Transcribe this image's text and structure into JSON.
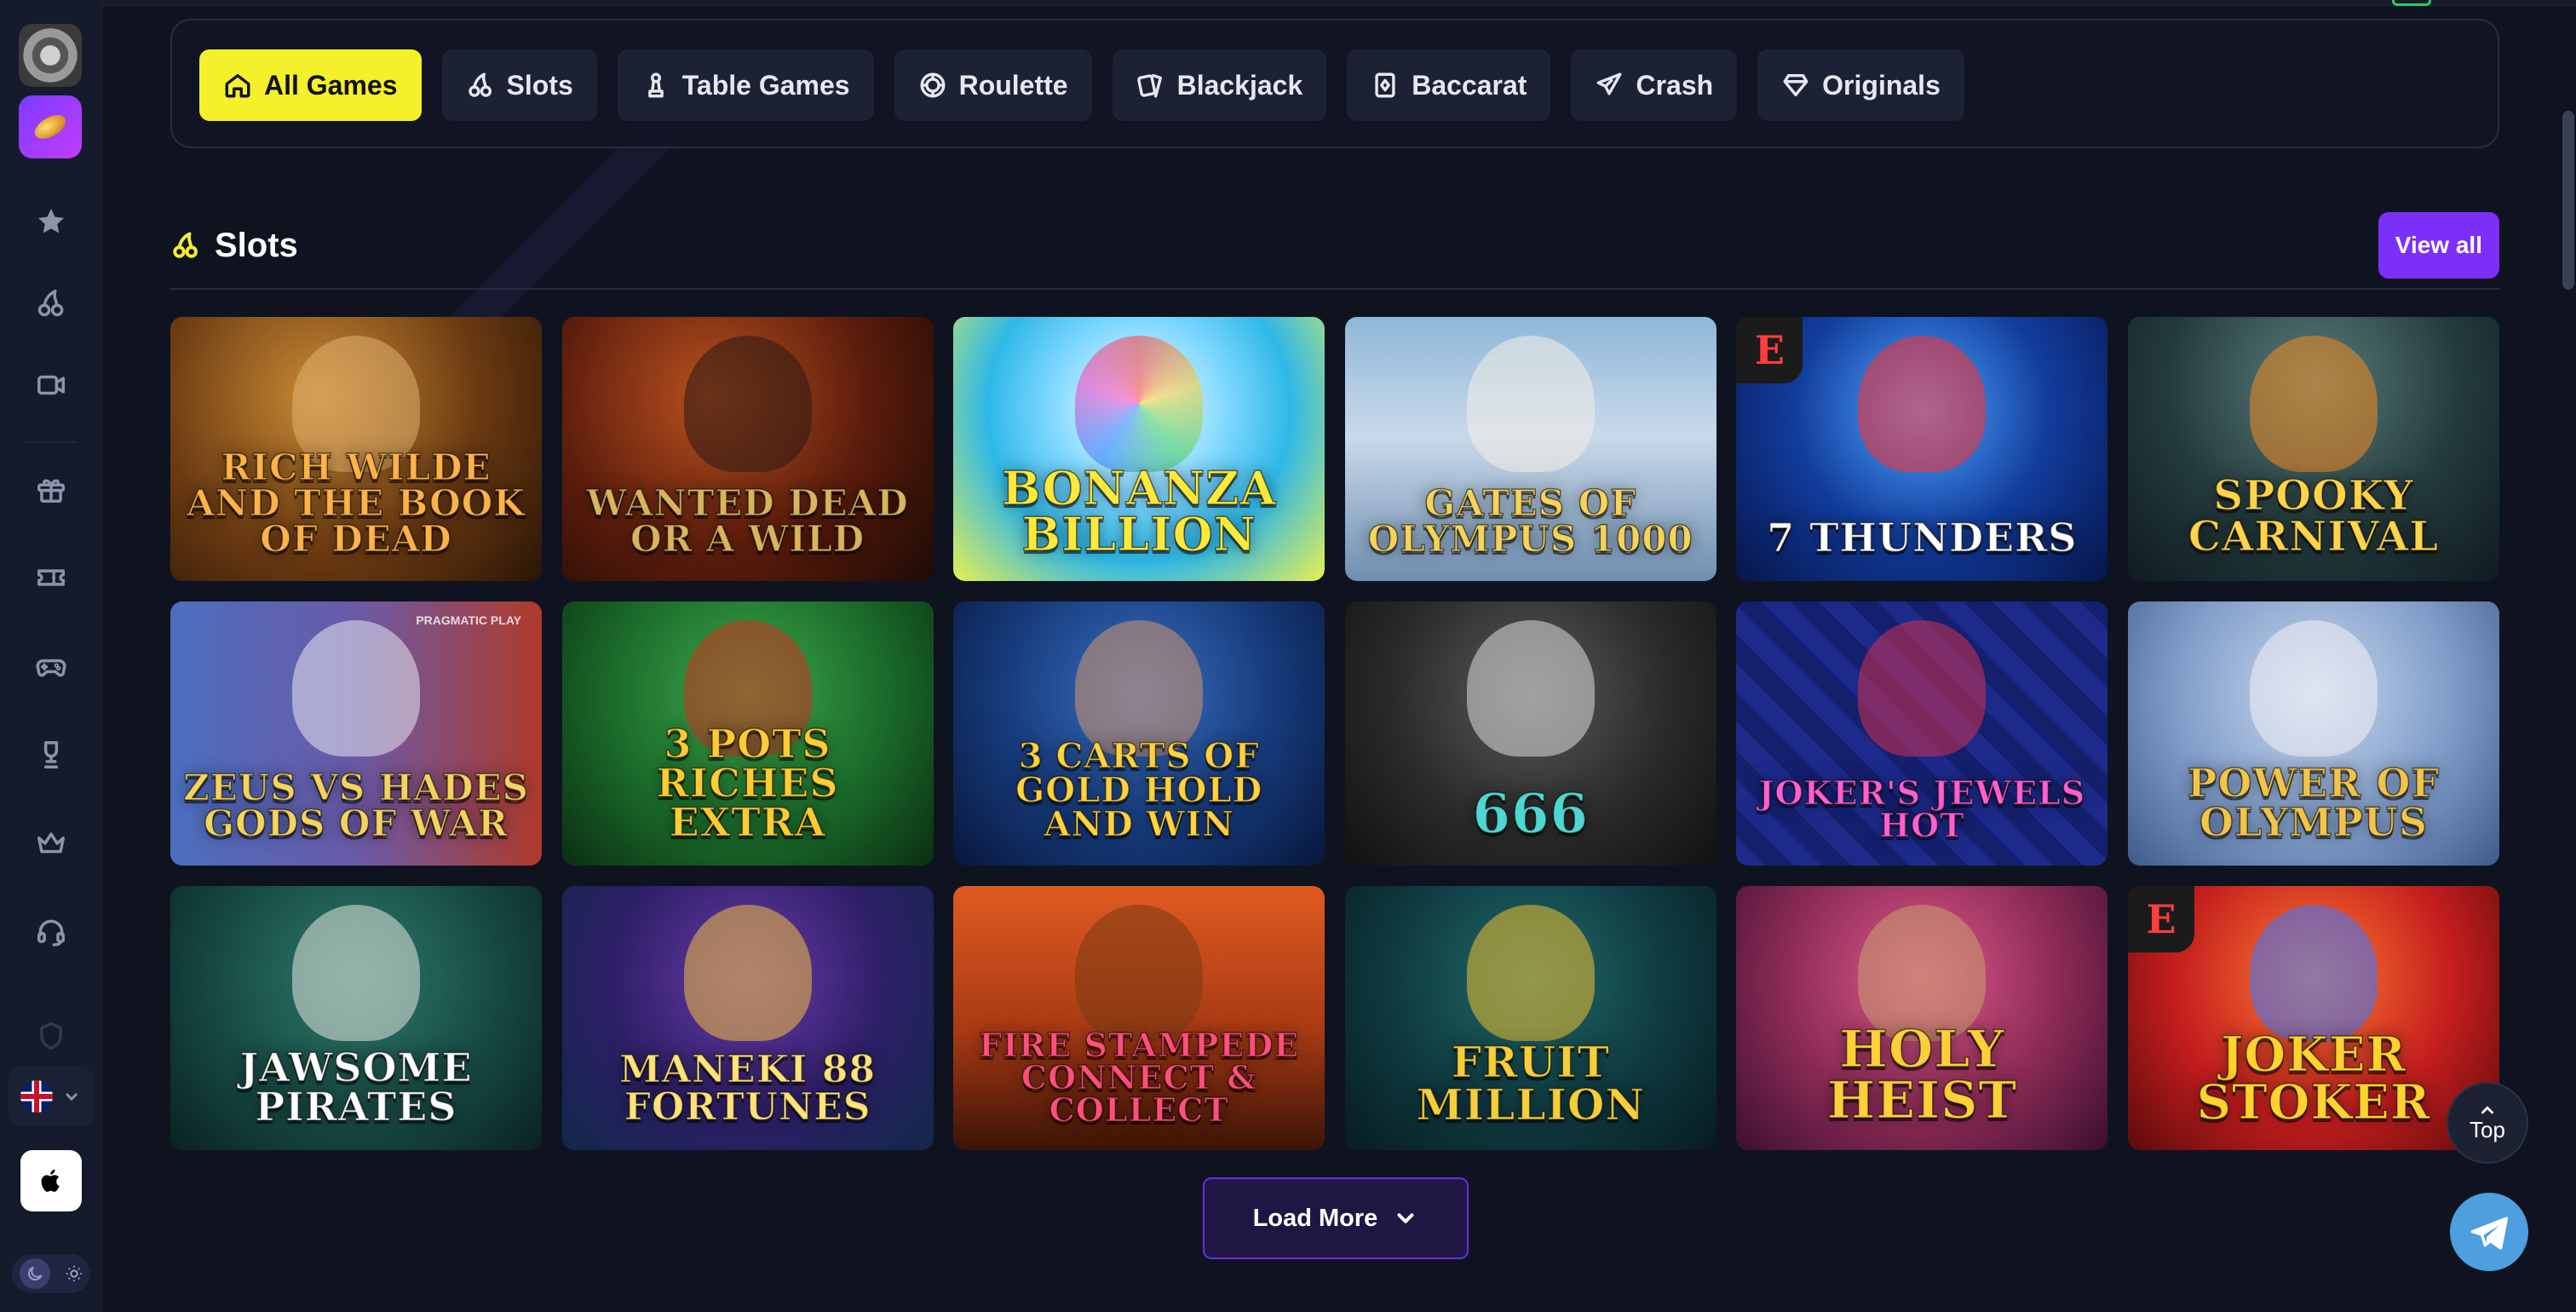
{
  "filters": [
    {
      "label": "All Games",
      "icon": "home-icon",
      "active": true
    },
    {
      "label": "Slots",
      "icon": "cherries-icon",
      "active": false
    },
    {
      "label": "Table Games",
      "icon": "chess-pawn-icon",
      "active": false
    },
    {
      "label": "Roulette",
      "icon": "roulette-wheel-icon",
      "active": false
    },
    {
      "label": "Blackjack",
      "icon": "playing-cards-icon",
      "active": false
    },
    {
      "label": "Baccarat",
      "icon": "card-diamond-icon",
      "active": false
    },
    {
      "label": "Crash",
      "icon": "plane-icon",
      "active": false
    },
    {
      "label": "Originals",
      "icon": "diamond-icon",
      "active": false
    }
  ],
  "section": {
    "title": "Slots",
    "icon": "cherries-icon",
    "view_all": "View all"
  },
  "games": [
    {
      "name": "Rich Wilde and the Book of Dead",
      "provider_badge": ""
    },
    {
      "name": "Wanted Dead or a Wild",
      "provider_badge": ""
    },
    {
      "name": "Bonanza Billion",
      "provider_badge": ""
    },
    {
      "name": "Gates of Olympus 1000",
      "provider_badge": ""
    },
    {
      "name": "7 Thunders",
      "provider_badge": "E"
    },
    {
      "name": "Spooky Carnival",
      "provider_badge": ""
    },
    {
      "name": "Zeus vs Hades Gods of War",
      "provider_badge": "",
      "corner_label": "PRAGMATIC PLAY"
    },
    {
      "name": "3 Pots Riches Extra",
      "provider_badge": ""
    },
    {
      "name": "3 Carts of Gold Hold and Win",
      "provider_badge": ""
    },
    {
      "name": "666",
      "provider_badge": ""
    },
    {
      "name": "Joker's Jewels Hot",
      "provider_badge": ""
    },
    {
      "name": "Power of Olympus",
      "provider_badge": ""
    },
    {
      "name": "Jawsome Pirates",
      "provider_badge": ""
    },
    {
      "name": "Maneki 88 Fortunes",
      "provider_badge": ""
    },
    {
      "name": "Fire Stampede Connect & Collect",
      "provider_badge": ""
    },
    {
      "name": "Fruit Million",
      "provider_badge": ""
    },
    {
      "name": "Holy Heist",
      "provider_badge": ""
    },
    {
      "name": "Joker Stoker",
      "provider_badge": "E"
    }
  ],
  "load_more": "Load More",
  "top_button": "Top",
  "sidebar": {
    "nav_icons": [
      "star-icon",
      "cherries-icon",
      "video-camera-icon",
      "gift-icon",
      "ticket-icon",
      "gamepad-icon",
      "trophy-icon",
      "crown-icon",
      "headset-icon"
    ],
    "language_icon": "uk-flag-icon",
    "app_icon": "apple-icon"
  },
  "colors": {
    "accent_yellow": "#f5f02c",
    "accent_purple": "#7b2ff7",
    "background": "#0f1320"
  }
}
